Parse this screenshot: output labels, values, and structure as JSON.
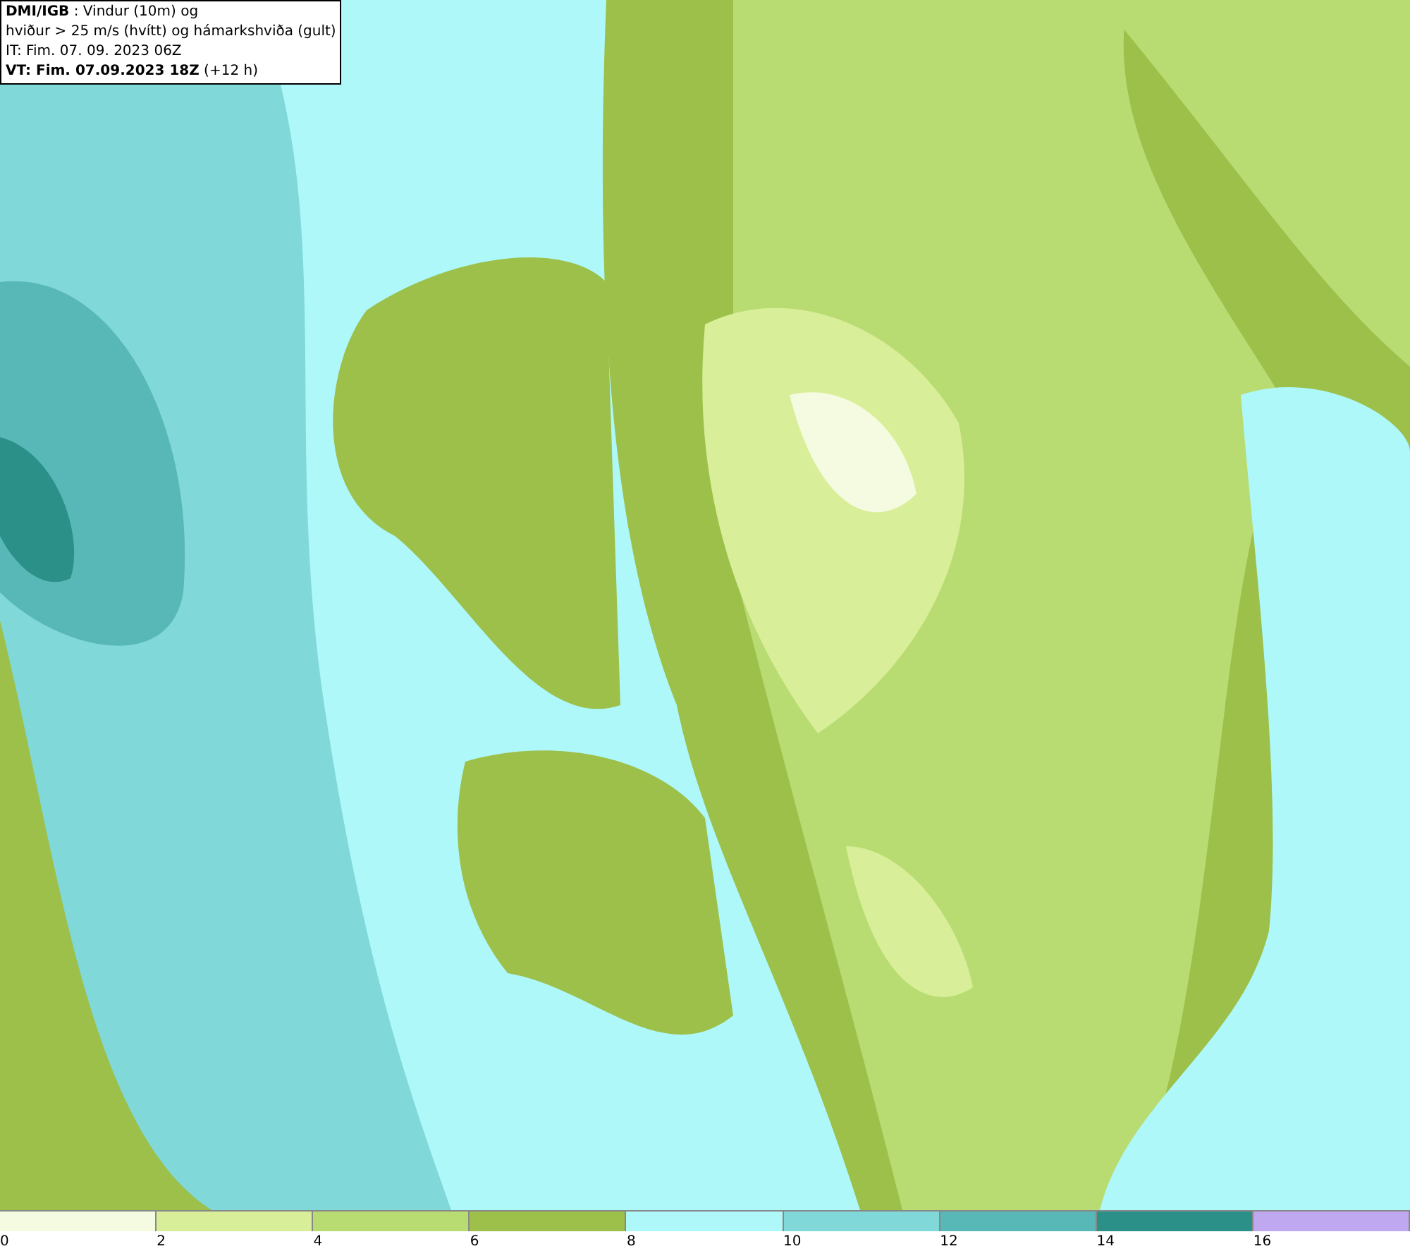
{
  "info_box": {
    "lines": [
      "**DMI/IGB** : Vindur (10m) og",
      "hviður > 25 m/s (hvítt) og hámarkshviða (gult)",
      "IT: Fim. 07. 09. 2023 06Z",
      "**VT: Fim. 07.09.2023 18Z** (+12 h)"
    ]
  },
  "legend": {
    "segments": [
      {
        "label": "0",
        "color": "#f5fbe0"
      },
      {
        "label": "2",
        "color": "#d8ee98"
      },
      {
        "label": "4",
        "color": "#b8dc72"
      },
      {
        "label": "6",
        "color": "#9cc04a"
      },
      {
        "label": "8",
        "color": "#aef8fa"
      },
      {
        "label": "10",
        "color": "#80d8d8"
      },
      {
        "label": "12",
        "color": "#58b8b8"
      },
      {
        "label": "14",
        "color": "#2a9088"
      },
      {
        "label": "16",
        "color": "#c0a8f0"
      }
    ]
  }
}
